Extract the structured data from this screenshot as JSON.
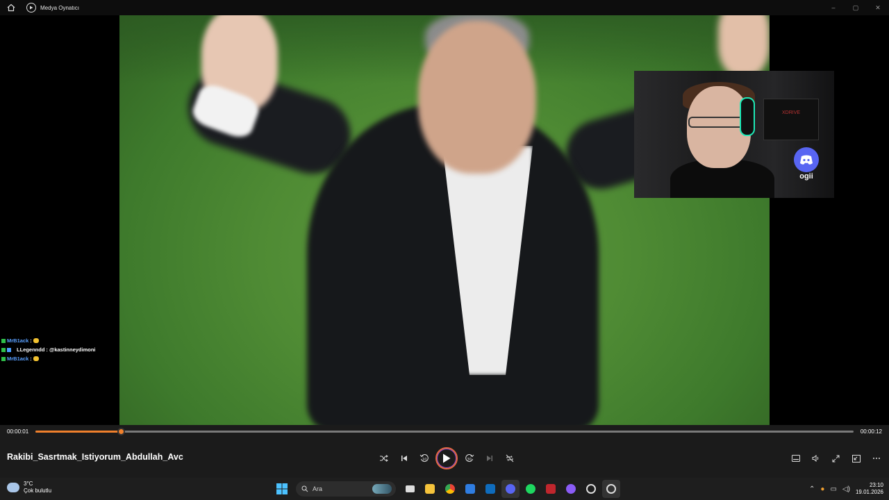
{
  "window": {
    "title": "Medya Oynatıcı"
  },
  "chat": [
    {
      "user": "MrB1ack",
      "message": ":",
      "user_color": "#5aa0ff"
    },
    {
      "user": "LLegenndd",
      "message": ": @kastinneydimoni",
      "user_color": "#ffffff"
    },
    {
      "user": "MrB1ack",
      "message": ":",
      "user_color": "#5aa0ff"
    }
  ],
  "webcam": {
    "name": "ogii"
  },
  "player": {
    "current_time": "00:00:01",
    "total_time": "00:00:12",
    "progress": 0.104,
    "track_title": "Rakibi_Sasrtmak_Istiyorum_Abdullah_Avc",
    "accent_color": "#f0802c"
  },
  "taskbar": {
    "weather_temp": "3°C",
    "weather_desc": "Çok bulutlu",
    "search_placeholder": "Ara",
    "time": "23:10",
    "date": "19.01.2026"
  }
}
